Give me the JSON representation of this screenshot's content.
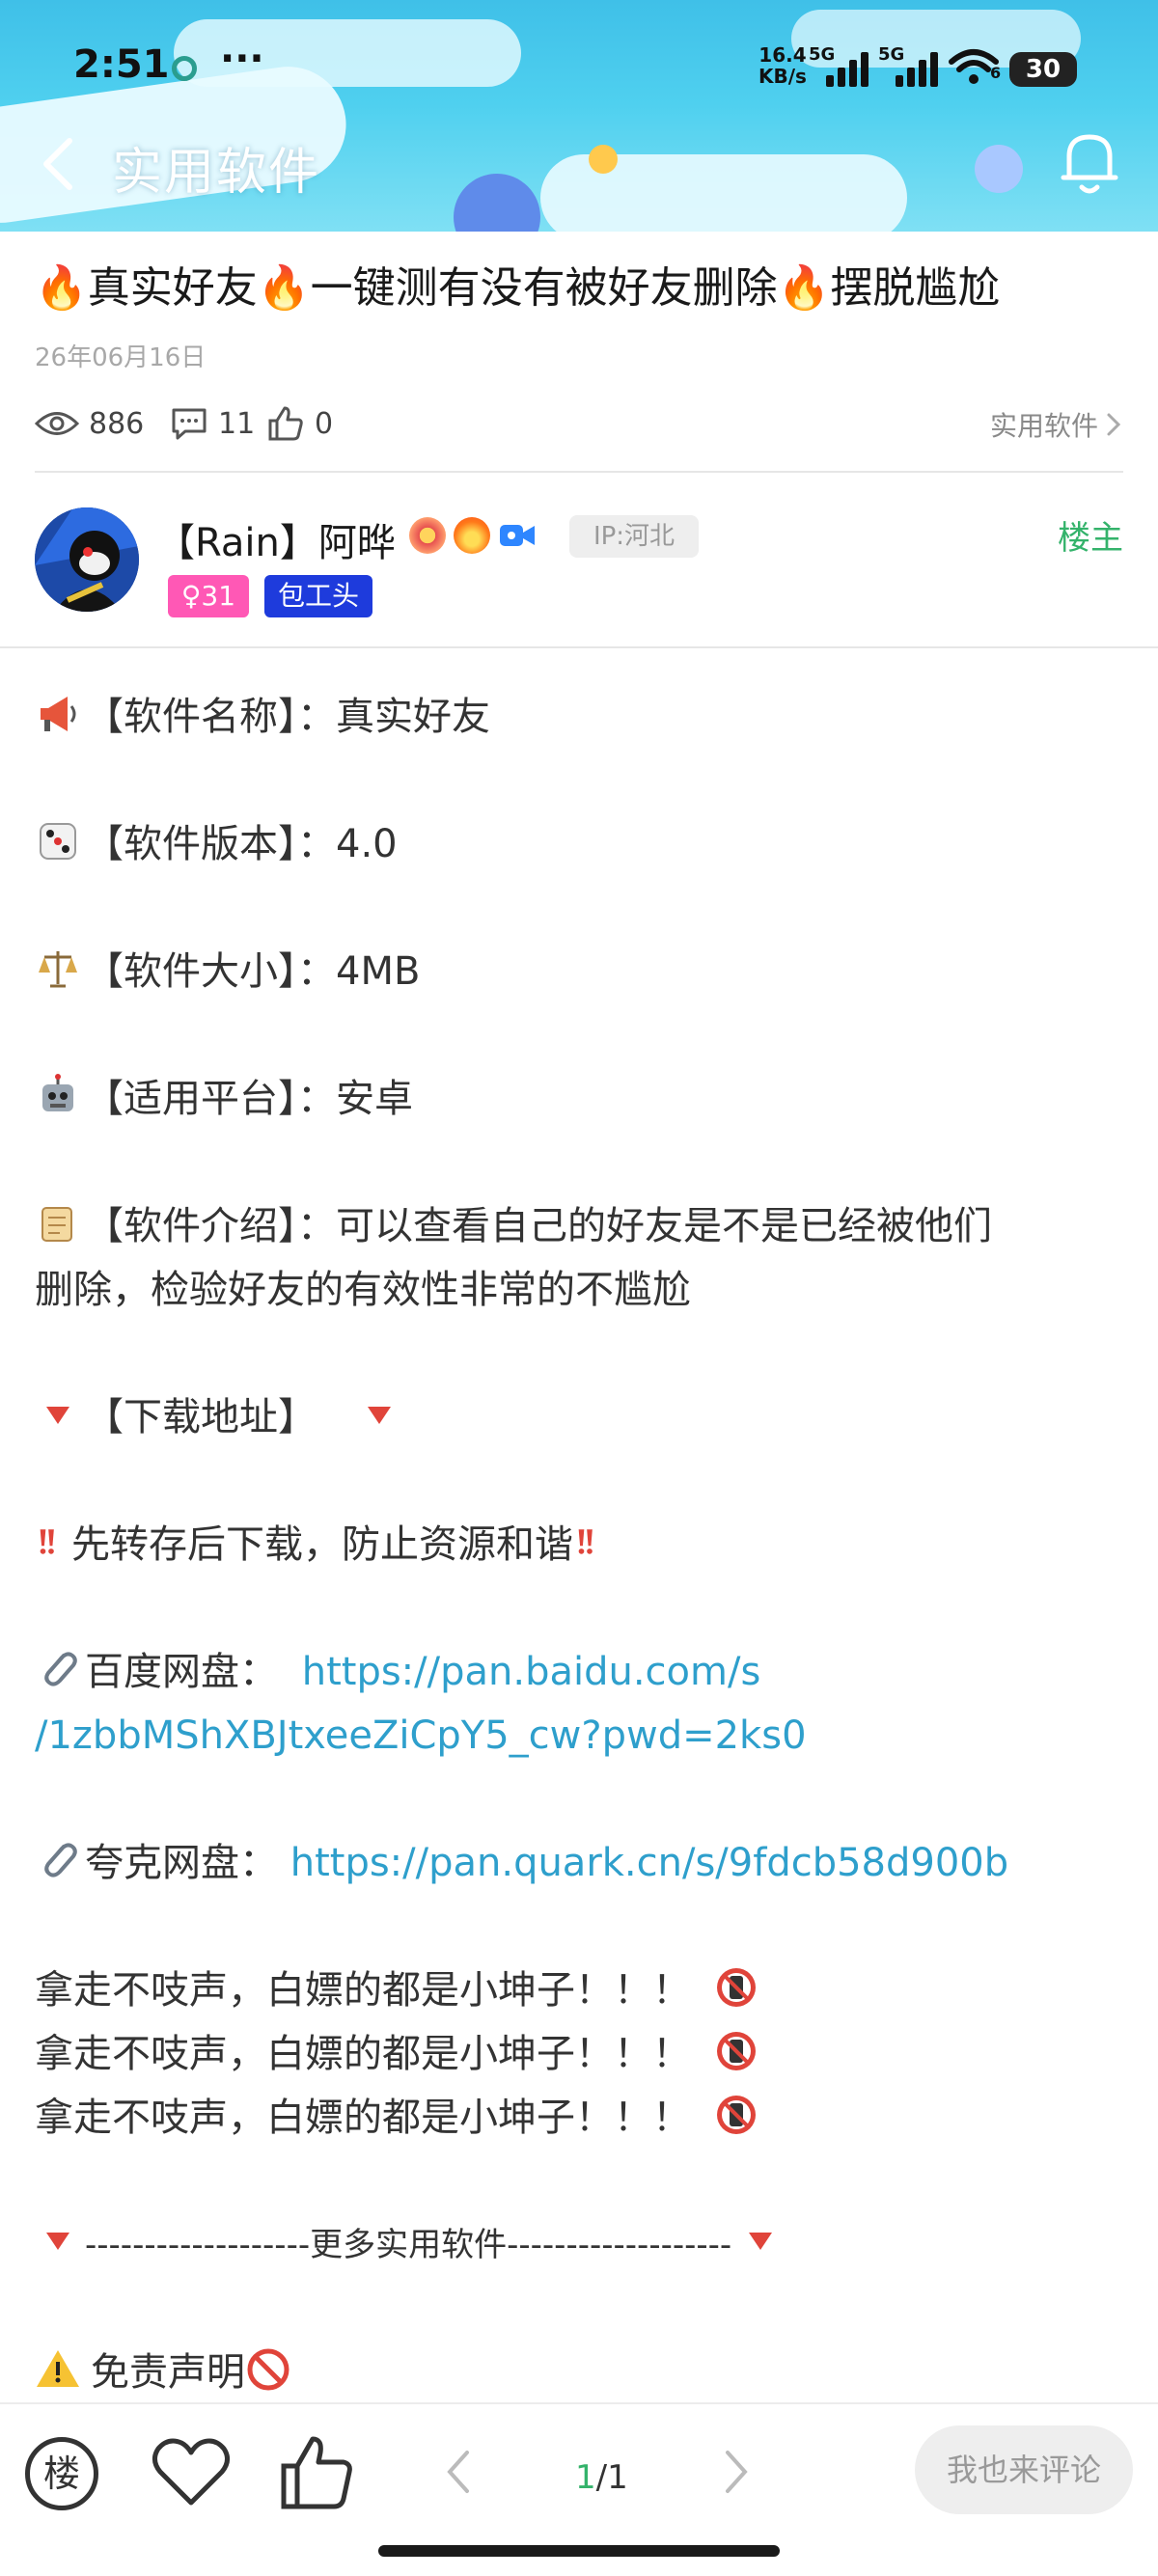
{
  "status_bar": {
    "time": "2:51",
    "more": "···",
    "net_speed_value": "16.4",
    "net_speed_unit": "KB/s",
    "signal1_label": "5G",
    "signal2_label": "5G",
    "wifi_sub": "6",
    "battery": "30"
  },
  "header": {
    "title": "实用软件",
    "back_icon": "chevron-left-icon",
    "bell_icon": "bell-icon"
  },
  "post": {
    "title": "🔥真实好友🔥一键测有没有被好友删除🔥摆脱尴尬",
    "date": "26年06月16日",
    "views": "886",
    "comments": "11",
    "likes": "0",
    "category": "实用软件"
  },
  "author": {
    "name": "【Rain】阿晔",
    "ip": "IP:河北",
    "owner_label": "楼主",
    "gender_level": "♀31",
    "role": "包工头"
  },
  "content": {
    "name_label": "【软件名称】：",
    "name_value": "真实好友",
    "version_label": "【软件版本】：",
    "version_value": "4.0",
    "size_label": "【软件大小】：",
    "size_value": "4MB",
    "platform_label": "【适用平台】：",
    "platform_value": "安卓",
    "intro_label": "【软件介绍】：",
    "intro_line1": "可以查看自己的好友是不是已经被他们",
    "intro_line2": "删除，检验好友的有效性非常的不尴尬",
    "download_label": "【下载地址】",
    "warning": "先转存后下载，防止资源和谐",
    "baidu_label": "百度网盘：",
    "baidu_url_line1": "https://pan.baidu.com/s",
    "baidu_url_line2": "/1zbbMShXBJtxeeZiCpY5_cw?pwd=2ks0",
    "quark_label": "夸克网盘：",
    "quark_url": "https://pan.quark.cn/s/9fdcb58d900b",
    "repeat_line": "拿走不吱声，白嫖的都是小坤子！！！",
    "more_divider": "-------------------更多实用软件-------------------",
    "disclaimer": "免责声明"
  },
  "bottom_bar": {
    "floor_label": "楼",
    "page_current": "1",
    "page_total": "/1",
    "comment_placeholder": "我也来评论"
  },
  "colors": {
    "accent_green": "#34b36b",
    "link_blue": "#2e9fcc",
    "header_sky": "#3fc0e8"
  }
}
